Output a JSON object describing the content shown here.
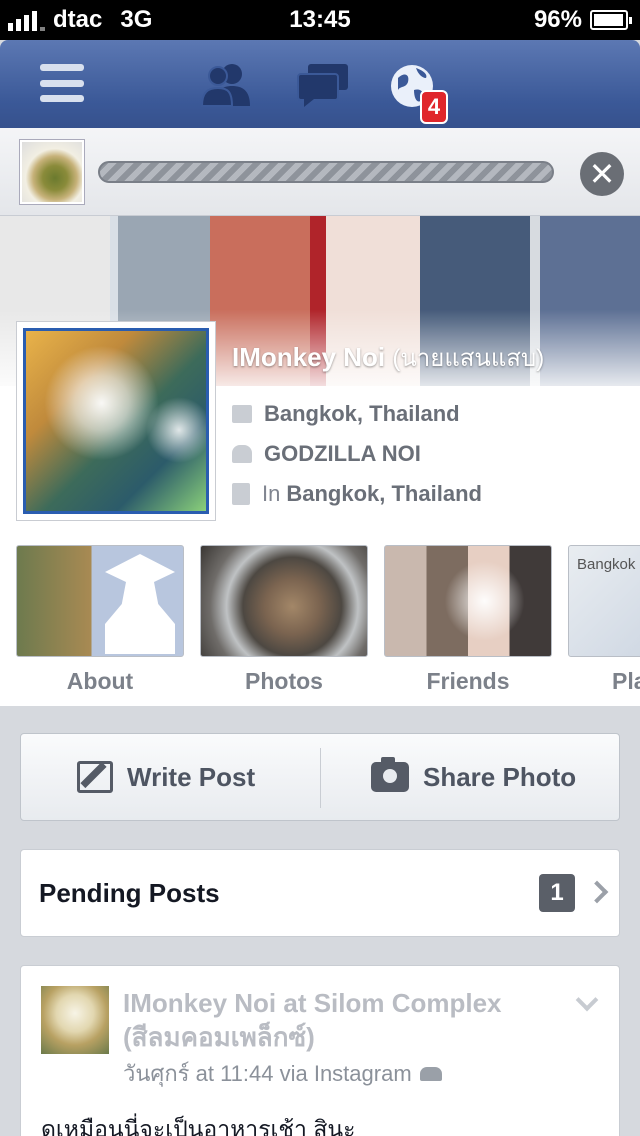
{
  "status_bar": {
    "carrier": "dtac",
    "network": "3G",
    "time": "13:45",
    "battery": "96%",
    "battery_level": 0.96
  },
  "navbar": {
    "menu_icon": "menu-icon",
    "friends_icon": "friend-requests-icon",
    "messages_icon": "messages-icon",
    "notifications_icon": "globe-notifications-icon",
    "notification_count": "4",
    "colors": {
      "bar": "#3b5998",
      "badge": "#e0262b"
    }
  },
  "upload": {
    "close_label": "✕",
    "progress": 1.0
  },
  "profile": {
    "name": "IMonkey Noi",
    "name_native": "(นายแสนแสบ)",
    "work": "Bangkok, Thailand",
    "education": "GODZILLA NOI",
    "lives_in_prefix": "In",
    "lives_in": "Bangkok, Thailand"
  },
  "tiles": [
    {
      "label": "About"
    },
    {
      "label": "Photos"
    },
    {
      "label": "Friends"
    },
    {
      "label": "Pla",
      "map_label": "Bangkok"
    }
  ],
  "actions": {
    "write_post": "Write Post",
    "share_photo": "Share Photo"
  },
  "pending": {
    "label": "Pending Posts",
    "count": "1"
  },
  "post": {
    "title": "IMonkey Noi at Silom Complex (สีลมคอมเพล็กซ์)",
    "meta": "วันศุกร์ at 11:44 via Instagram",
    "body": "ดูเหมือนนี่จะเป็นอาหารเช้า สินะ"
  }
}
